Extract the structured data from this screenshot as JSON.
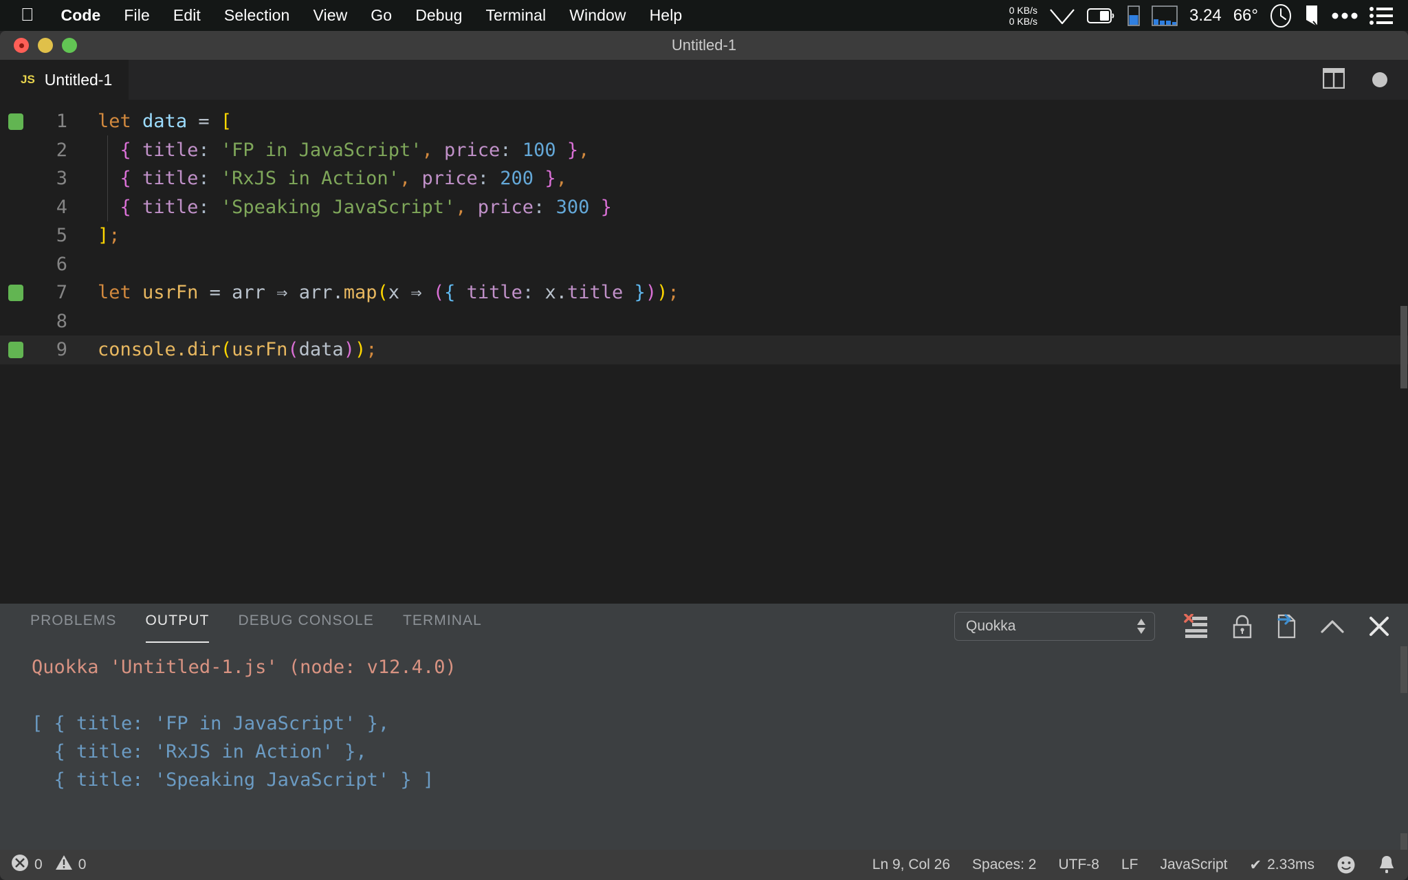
{
  "menubar": {
    "apple_icon": "apple-logo-icon",
    "items": [
      {
        "label": "Code",
        "bold": true
      },
      {
        "label": "File",
        "bold": false
      },
      {
        "label": "Edit",
        "bold": false
      },
      {
        "label": "Selection",
        "bold": false
      },
      {
        "label": "View",
        "bold": false
      },
      {
        "label": "Go",
        "bold": false
      },
      {
        "label": "Debug",
        "bold": false
      },
      {
        "label": "Terminal",
        "bold": false
      },
      {
        "label": "Window",
        "bold": false
      },
      {
        "label": "Help",
        "bold": false
      }
    ],
    "net_up": "0 KB/s",
    "net_down": "0 KB/s",
    "load_average": "3.24",
    "temperature": "66°",
    "status_icons": [
      "wifi-icon",
      "battery-icon",
      "memory-gauge-icon",
      "cpu-history-icon",
      "clock-icon",
      "bookmark-icon",
      "ellipsis-icon",
      "list-menu-icon"
    ]
  },
  "window": {
    "title": "Untitled-1",
    "traffic_lights": [
      "close-button",
      "minimize-button",
      "maximize-button"
    ]
  },
  "tabstrip": {
    "tab": {
      "badge": "JS",
      "label": "Untitled-1"
    },
    "actions": [
      "split-editor-icon",
      "unsaved-dot-icon"
    ]
  },
  "editor": {
    "lines": [
      {
        "no": "1",
        "marker": true,
        "current": false
      },
      {
        "no": "2",
        "marker": false,
        "current": false
      },
      {
        "no": "3",
        "marker": false,
        "current": false
      },
      {
        "no": "4",
        "marker": false,
        "current": false
      },
      {
        "no": "5",
        "marker": false,
        "current": false
      },
      {
        "no": "6",
        "marker": false,
        "current": false
      },
      {
        "no": "7",
        "marker": true,
        "current": false
      },
      {
        "no": "8",
        "marker": false,
        "current": false
      },
      {
        "no": "9",
        "marker": true,
        "current": true
      }
    ],
    "code": {
      "l1": "let data = [",
      "l2": "  { title: 'FP in JavaScript', price: 100 },",
      "l3": "  { title: 'RxJS in Action', price: 200 },",
      "l4": "  { title: 'Speaking JavaScript', price: 300 }",
      "l5": "];",
      "l6": "",
      "l7": "let usrFn = arr => arr.map(x => ({ title: x.title }));",
      "l8": "",
      "l9": "console.dir(usrFn(data));"
    },
    "tokens": {
      "kw_let": "let",
      "sp": " ",
      "var_data": "data",
      "eq": "=",
      "br_open": "[",
      "indent": "  ",
      "brace_open": "{",
      "prop_title": "title",
      "colon": ":",
      "str1": "'FP in JavaScript'",
      "str2": "'RxJS in Action'",
      "str3": "'Speaking JavaScript'",
      "comma": ",",
      "prop_price": "price",
      "num1": "100",
      "num2": "200",
      "num3": "300",
      "brace_close": "}",
      "br_close": "]",
      "semi": ";",
      "var_usrFn": "usrFn",
      "var_arr": "arr",
      "arrow": "⇒",
      "dot": ".",
      "fn_map": "map",
      "paren_open": "(",
      "paren_close": ")",
      "var_x": "x",
      "obj_console": "console",
      "fn_dir": "dir"
    }
  },
  "panel": {
    "tabs": [
      {
        "label": "PROBLEMS",
        "active": false
      },
      {
        "label": "OUTPUT",
        "active": true
      },
      {
        "label": "DEBUG CONSOLE",
        "active": false
      },
      {
        "label": "TERMINAL",
        "active": false
      }
    ],
    "channel": "Quokka",
    "actions": [
      "clear-output-icon",
      "lock-scroll-icon",
      "open-in-editor-icon",
      "maximize-panel-icon",
      "close-panel-icon"
    ],
    "output": {
      "header": "Quokka 'Untitled-1.js' (node: v12.4.0)",
      "lines": [
        "[ { title: 'FP in JavaScript' },",
        "  { title: 'RxJS in Action' },",
        "  { title: 'Speaking JavaScript' } ]"
      ]
    }
  },
  "statusbar": {
    "errors": "0",
    "warnings": "0",
    "cursor": "Ln 9, Col 26",
    "indent": "Spaces: 2",
    "encoding": "UTF-8",
    "eol": "LF",
    "language": "JavaScript",
    "quokka_time": "2.33ms",
    "quokka_check": "✔",
    "icons": [
      "error-icon",
      "warning-icon",
      "feedback-smiley-icon",
      "bell-icon"
    ]
  },
  "colors": {
    "accent_green": "#62b552",
    "editor_bg": "#1e1e1e",
    "panel_bg": "#3c3f41",
    "statusbar_bg": "#3c3c3c",
    "output_text": "#6b9bc3",
    "output_header": "#d99382"
  }
}
